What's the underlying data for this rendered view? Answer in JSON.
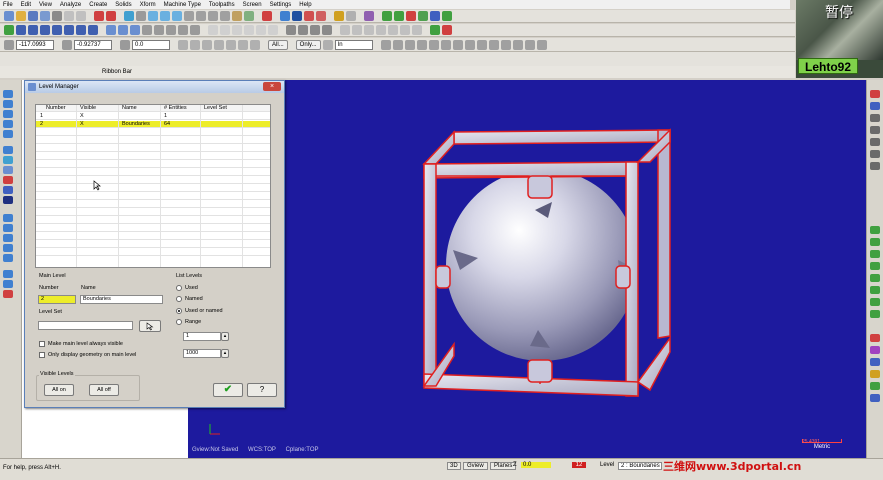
{
  "menu": [
    "File",
    "Edit",
    "View",
    "Analyze",
    "Create",
    "Solids",
    "Xform",
    "Machine Type",
    "Toolpaths",
    "Screen",
    "Settings",
    "Help"
  ],
  "toolbar3": {
    "x_value": "-117.0993",
    "y_value": "-0.92737",
    "z_value": "0.0",
    "all_label": "All...",
    "only_label": "Only...",
    "mode_value": "In"
  },
  "ribbon_label": "Ribbon Bar",
  "webcam": {
    "name": "Lehto92",
    "paused": "暂停"
  },
  "dialog": {
    "title": "Level Manager",
    "columns": [
      "Number",
      "Visible",
      "Name",
      "# Entities",
      "Level Set"
    ],
    "rows": [
      {
        "number": "1",
        "visible": "X",
        "name": "",
        "entities": "1",
        "level_set": ""
      },
      {
        "number": "2",
        "visible": "X",
        "name": "Boundaries",
        "entities": "64",
        "level_set": ""
      }
    ],
    "main_level": {
      "title": "Main Level",
      "number_label": "Number",
      "name_label": "Name",
      "number_value": "2",
      "name_value": "Boundaries",
      "level_set_label": "Level Set",
      "level_set_value": "",
      "make_visible_label": "Make main level always visible",
      "only_display_label": "Only display geometry on main level"
    },
    "list_levels": {
      "title": "List Levels",
      "options": [
        "Used",
        "Named",
        "Used or named",
        "Range"
      ],
      "selected": "Used or named",
      "range_from": "1",
      "range_to": "1000"
    },
    "visible_levels": {
      "title": "Visible Levels",
      "all_on": "All on",
      "all_off": "All off"
    }
  },
  "viewport": {
    "gview": "Gview:Not Saved",
    "wcs": "WCS:TOP",
    "cplane": "Cplane:TOP",
    "scale_value": "25.4391",
    "scale_unit": "Metric"
  },
  "status": {
    "help": "For help, press Alt+H.",
    "mode": "3D",
    "gview": "Gview",
    "planes": "Planes",
    "z_label": "Z",
    "z_value": "0.0",
    "color_value": "12",
    "level_label": "Level",
    "level_value": "2 : Boundaries",
    "watermark": "三维网www.3dportal.cn"
  },
  "colors": {
    "viewport_bg": "#1d1a9e",
    "selected_row": "#eded2a",
    "cam_badge": "#7fd14a",
    "accent_red": "#d01010"
  }
}
